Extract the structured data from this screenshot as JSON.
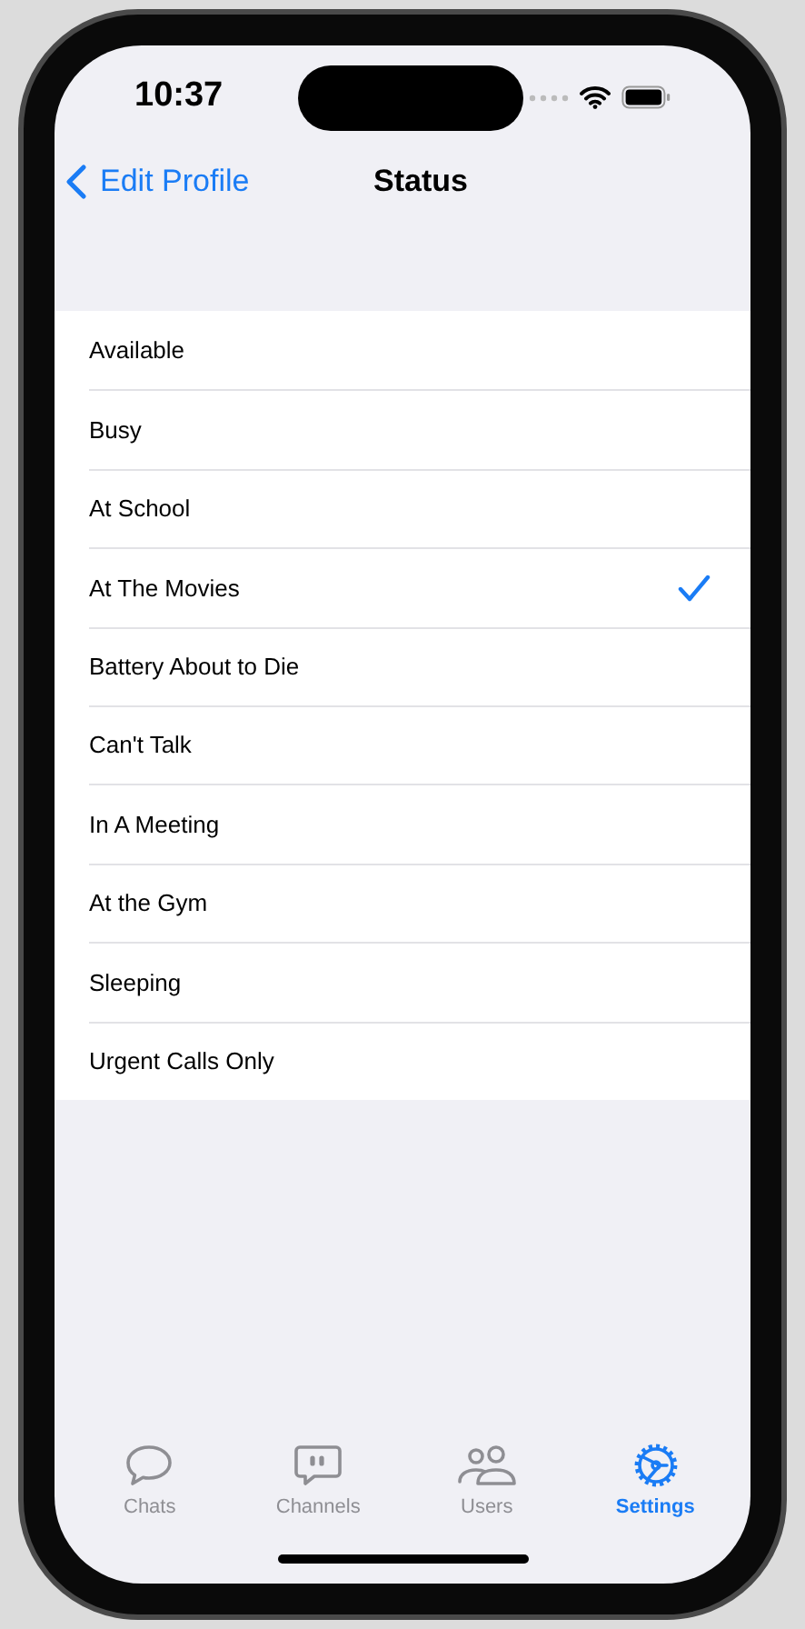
{
  "status_bar": {
    "time": "10:37"
  },
  "nav": {
    "back": "Edit Profile",
    "title": "Status"
  },
  "statuses": [
    {
      "label": "Available",
      "selected": false
    },
    {
      "label": "Busy",
      "selected": false
    },
    {
      "label": "At School",
      "selected": false
    },
    {
      "label": "At The Movies",
      "selected": true
    },
    {
      "label": "Battery About to Die",
      "selected": false
    },
    {
      "label": "Can't Talk",
      "selected": false
    },
    {
      "label": "In A Meeting",
      "selected": false
    },
    {
      "label": "At the Gym",
      "selected": false
    },
    {
      "label": "Sleeping",
      "selected": false
    },
    {
      "label": "Urgent Calls Only",
      "selected": false
    }
  ],
  "tabs": [
    {
      "kind": "chats",
      "label": "Chats",
      "selected": false
    },
    {
      "kind": "channels",
      "label": "Channels",
      "selected": false
    },
    {
      "kind": "users",
      "label": "Users",
      "selected": false
    },
    {
      "kind": "settings",
      "label": "Settings",
      "selected": true
    }
  ]
}
